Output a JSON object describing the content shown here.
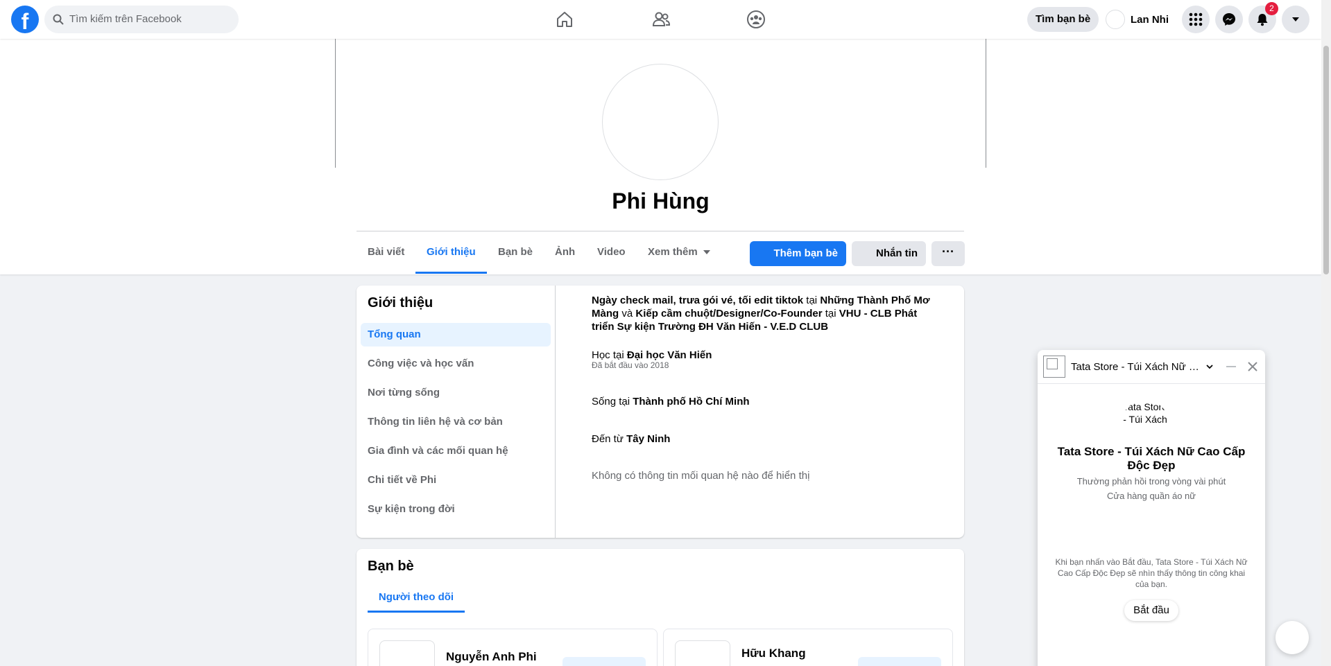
{
  "topbar": {
    "logo": "f",
    "search_placeholder": "Tìm kiếm trên Facebook",
    "nav_icons": [
      "home-icon",
      "friends-icon",
      "groups-icon"
    ],
    "find_friends_label": "Tìm bạn bè",
    "user_name": "Lan Nhi",
    "notifications_count": "2",
    "right_icons": [
      "menu-grid-icon",
      "messenger-icon",
      "bell-icon",
      "account-caret-icon"
    ]
  },
  "profile": {
    "name": "Phi Hùng",
    "tabs": [
      {
        "label": "Bài viết",
        "active": false
      },
      {
        "label": "Giới thiệu",
        "active": true
      },
      {
        "label": "Bạn bè",
        "active": false
      },
      {
        "label": "Ảnh",
        "active": false
      },
      {
        "label": "Video",
        "active": false
      },
      {
        "label": "Xem thêm",
        "active": false
      }
    ],
    "add_friend_label": "Thêm bạn bè",
    "message_label": "Nhắn tin",
    "more_label": "···"
  },
  "about": {
    "title": "Giới thiệu",
    "menu": [
      {
        "label": "Tổng quan",
        "active": true
      },
      {
        "label": "Công việc và học vấn",
        "active": false
      },
      {
        "label": "Nơi từng sống",
        "active": false
      },
      {
        "label": "Thông tin liên hệ và cơ bản",
        "active": false
      },
      {
        "label": "Gia đình và các mối quan hệ",
        "active": false
      },
      {
        "label": "Chi tiết về Phi",
        "active": false
      },
      {
        "label": "Sự kiện trong đời",
        "active": false
      }
    ],
    "work": {
      "role1": "Ngày check mail, trưa gói vé, tối edit tiktok",
      "at1": "tại",
      "place1": "Những Thành Phố Mơ Màng",
      "and": "và",
      "role2": "Kiếp cầm chuột/Designer/Co-Founder",
      "at2": "tại",
      "place2": "VHU - CLB Phát triển Sự kiện Trường ĐH Văn Hiến - V.E.D CLUB"
    },
    "education": {
      "prefix": "Học tại",
      "school": "Đại học Văn Hiến",
      "since": "Đã bắt đầu vào 2018"
    },
    "lives": {
      "prefix": "Sống tại",
      "place": "Thành phố Hồ Chí Minh"
    },
    "from": {
      "prefix": "Đến từ",
      "place": "Tây Ninh"
    },
    "relationship_empty": "Không có thông tin mối quan hệ nào để hiển thị"
  },
  "friends": {
    "title": "Bạn bè",
    "tab_label": "Người theo dõi",
    "items": [
      {
        "name": "Nguyễn Anh Phi"
      },
      {
        "name": "Hữu Khang"
      }
    ]
  },
  "chat": {
    "title": "Tata Store - Túi Xách Nữ Cao Cấp Độc Đẹp",
    "avatar_alt": "Tata Store - Túi Xách",
    "name": "Tata Store - Túi Xách Nữ Cao Cấp Độc Đẹp",
    "response_time": "Thường phản hồi trong vòng vài phút",
    "category": "Cửa hàng quần áo nữ",
    "notice": "Khi bạn nhấn vào Bắt đầu, Tata Store - Túi Xách Nữ Cao Cấp Độc Đẹp sẽ nhìn thấy thông tin công khai của bạn.",
    "start_label": "Bắt đầu"
  },
  "colors": {
    "accent": "#1877f2",
    "background": "#f0f2f5",
    "badge": "#e41e3f"
  }
}
